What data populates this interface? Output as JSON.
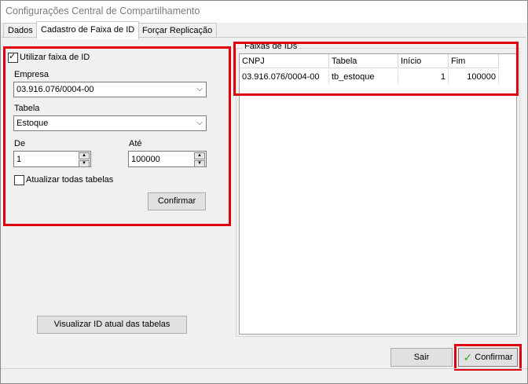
{
  "window": {
    "title": "Configurações Central de Compartilhamento"
  },
  "tabs": [
    {
      "label": "Dados"
    },
    {
      "label": "Cadastro de Faixa de ID"
    },
    {
      "label": "Forçar Replicação"
    }
  ],
  "form": {
    "use_range_label": "Utilizar faixa de ID",
    "use_range_checked": true,
    "empresa_label": "Empresa",
    "empresa_value": "03.916.076/0004-00",
    "tabela_label": "Tabela",
    "tabela_value": "Estoque",
    "de_label": "De",
    "de_value": "1",
    "ate_label": "Até",
    "ate_value": "100000",
    "update_all_label": "Atualizar todas tabelas",
    "update_all_checked": false,
    "confirm_label": "Confirmar",
    "view_current_label": "Visualizar ID atual das tabelas"
  },
  "ranges": {
    "group_title": "Faixas de IDs",
    "columns": [
      "CNPJ",
      "Tabela",
      "Início",
      "Fim"
    ],
    "rows": [
      {
        "cnpj": "03.916.076/0004-00",
        "tabela": "tb_estoque",
        "inicio": "1",
        "fim": "100000"
      }
    ]
  },
  "footer": {
    "exit_label": "Sair",
    "confirm_label": "Confirmar"
  },
  "colors": {
    "highlight": "#e0000d",
    "check_green": "#3aa13a"
  }
}
